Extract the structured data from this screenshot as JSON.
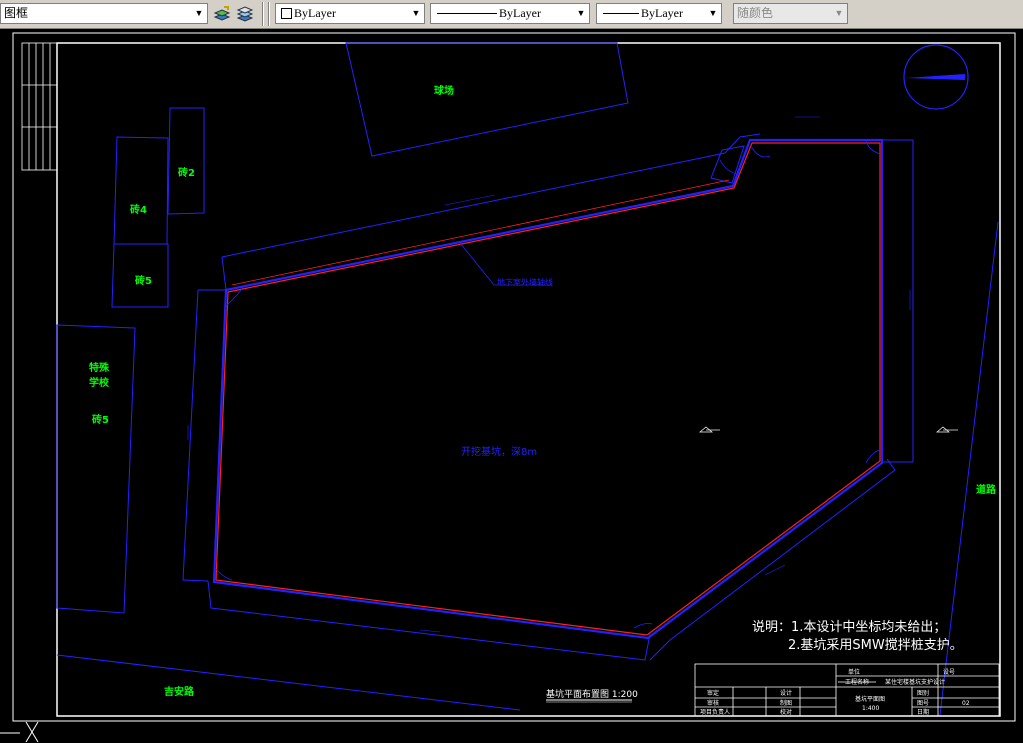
{
  "toolbar": {
    "layer_combo": "图框",
    "color_combo": "ByLayer",
    "linetype_combo": "ByLayer",
    "lineweight_combo": "ByLayer",
    "plotstyle_combo": "随颜色"
  },
  "drawing": {
    "labels": {
      "sports_field": "球场",
      "brick2": "砖2",
      "brick4": "砖4",
      "brick5_a": "砖5",
      "special_school_1": "特殊",
      "special_school_2": "学校",
      "brick5_b": "砖5",
      "road_right": "道路",
      "road_bottom": "吉安路",
      "pit_label": "开挖基坑，深8m",
      "underground_wall": "地下室外墙轴线"
    },
    "notes": {
      "line1": "说明：1.本设计中坐标均未给出；",
      "line2": "2.基坑采用SMW搅拌桩支护。"
    },
    "drawing_title": "基坑平面布置图  1:200",
    "title_block": {
      "unit": "单位",
      "project_name": "工程名称",
      "design_no": "设号",
      "project_value": "某住宅楼基坑支护设计",
      "reviewer": "审定",
      "checker": "审核",
      "designer": "设计",
      "drafter": "制图",
      "project_lead": "项目负责人",
      "proofreader": "校对",
      "sheet_title": "基坑平面图",
      "scale": "1:400",
      "drawing_label": "图别",
      "drawing_no_label": "图号",
      "date_label": "日期",
      "sheet_no": "02"
    }
  },
  "colors": {
    "building_outline": "#2222ff",
    "label_green": "#00ff00",
    "pit_red": "#ff2020",
    "white": "#ffffff"
  }
}
